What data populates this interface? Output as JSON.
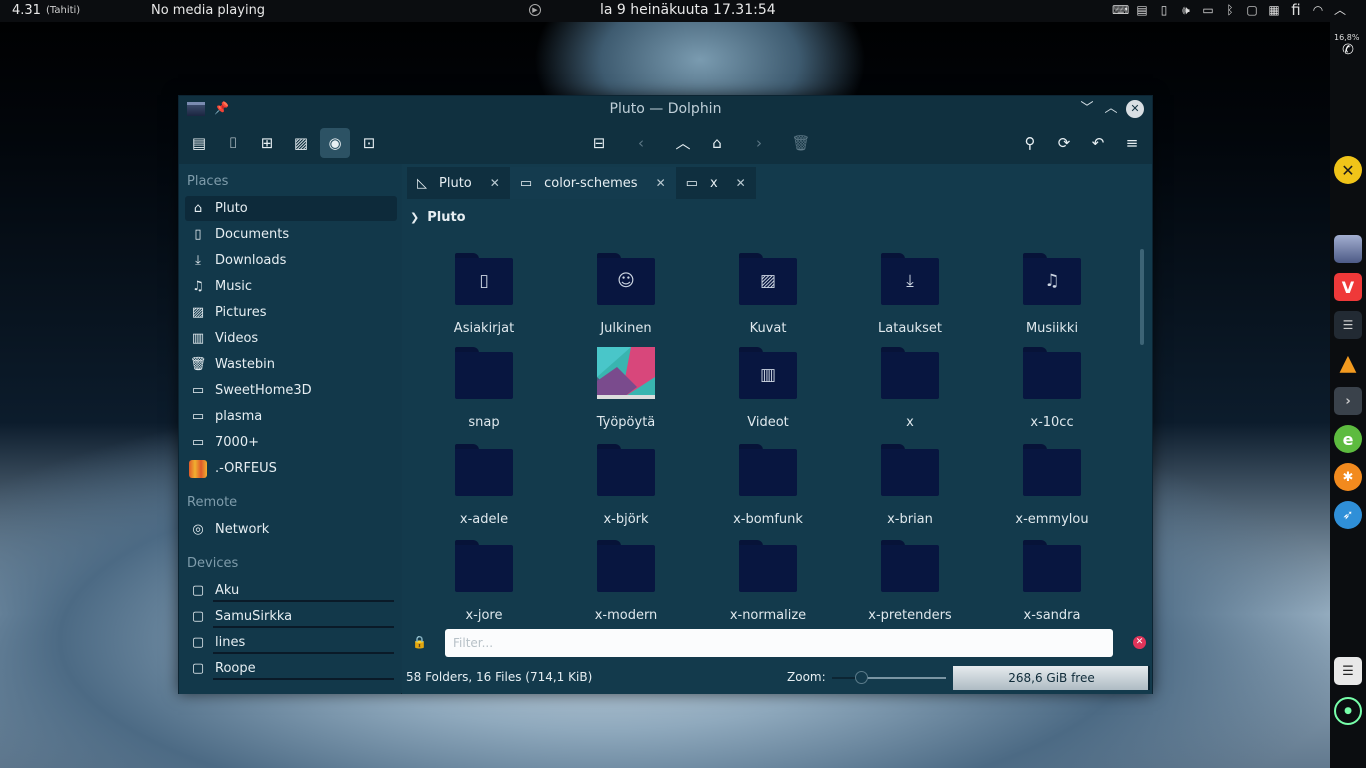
{
  "top_panel": {
    "temperature": "4.31",
    "location": "(Tahiti)",
    "media": "No media playing",
    "clock": "la 9 heinäkuuta 17.31:54",
    "tray_icons": [
      "keyboard-icon",
      "clipboard-icon",
      "phone-icon",
      "volume-icon",
      "display-icon",
      "bluetooth-icon",
      "lock-icon",
      "notes-icon"
    ],
    "language": "fi",
    "network_icon": "wifi-icon"
  },
  "dock": {
    "battery_percent": "16,8%",
    "items": [
      "phone-icon",
      "x-app-icon",
      "files-icon",
      "vivaldi-icon",
      "mixer-icon",
      "vlc-icon",
      "terminal-icon",
      "editor-icon",
      "orange-icon",
      "bird-icon",
      "notes-icon",
      "system-monitor-icon"
    ]
  },
  "window": {
    "title": "Pluto — Dolphin",
    "titlebar_buttons": [
      "minimize",
      "maximize",
      "close"
    ]
  },
  "toolbar": {
    "left_tools": [
      "panels-icon",
      "terminal-icon",
      "new-window-icon",
      "preview-icon",
      "eye-icon",
      "new-tab-icon"
    ],
    "center_tools": [
      "split-icon",
      "back-icon",
      "up-icon",
      "home-icon",
      "forward-icon",
      "trash-icon"
    ],
    "right_tools": [
      "search-icon",
      "reload-icon",
      "undo-icon",
      "menu-icon"
    ]
  },
  "sidebar": {
    "places_title": "Places",
    "places": [
      {
        "label": "Pluto",
        "icon": "home-icon",
        "selected": true
      },
      {
        "label": "Documents",
        "icon": "document-icon"
      },
      {
        "label": "Downloads",
        "icon": "download-icon"
      },
      {
        "label": "Music",
        "icon": "music-icon"
      },
      {
        "label": "Pictures",
        "icon": "picture-icon"
      },
      {
        "label": "Videos",
        "icon": "video-icon"
      },
      {
        "label": "Wastebin",
        "icon": "trash-icon"
      },
      {
        "label": "SweetHome3D",
        "icon": "folder-icon"
      },
      {
        "label": "plasma",
        "icon": "folder-icon"
      },
      {
        "label": "7000+",
        "icon": "folder-icon"
      },
      {
        "label": ".-ORFEUS",
        "icon": "orfeus-icon"
      }
    ],
    "remote_title": "Remote",
    "remote": [
      {
        "label": "Network",
        "icon": "network-icon"
      }
    ],
    "devices_title": "Devices",
    "devices": [
      {
        "label": "Aku",
        "icon": "drive-icon"
      },
      {
        "label": "SamuSirkka",
        "icon": "drive-icon"
      },
      {
        "label": "lines",
        "icon": "drive-icon"
      },
      {
        "label": "Roope",
        "icon": "drive-icon"
      }
    ]
  },
  "tabs": [
    {
      "label": "Pluto",
      "icon": "pluto-icon",
      "active": true
    },
    {
      "label": "color-schemes",
      "icon": "folder-icon",
      "active": false
    },
    {
      "label": "x",
      "icon": "folder-icon",
      "active": true
    }
  ],
  "breadcrumb": {
    "label": "Pluto"
  },
  "files": [
    {
      "name": "Asiakirjat",
      "glyph": "document-glyph"
    },
    {
      "name": "Julkinen",
      "glyph": "people-glyph"
    },
    {
      "name": "Kuvat",
      "glyph": "picture-glyph"
    },
    {
      "name": "Lataukset",
      "glyph": "download-glyph"
    },
    {
      "name": "Musiikki",
      "glyph": "music-glyph"
    },
    {
      "name": "snap",
      "glyph": ""
    },
    {
      "name": "Työpöytä",
      "glyph": "wallpaper-thumbnail"
    },
    {
      "name": "Videot",
      "glyph": "video-glyph"
    },
    {
      "name": "x",
      "glyph": ""
    },
    {
      "name": "x-10cc",
      "glyph": ""
    },
    {
      "name": "x-adele",
      "glyph": ""
    },
    {
      "name": "x-björk",
      "glyph": ""
    },
    {
      "name": "x-bomfunk",
      "glyph": ""
    },
    {
      "name": "x-brian",
      "glyph": ""
    },
    {
      "name": "x-emmylou",
      "glyph": ""
    },
    {
      "name": "x-jore",
      "glyph": ""
    },
    {
      "name": "x-modern",
      "glyph": ""
    },
    {
      "name": "x-normalize",
      "glyph": ""
    },
    {
      "name": "x-pretenders",
      "glyph": ""
    },
    {
      "name": "x-sandra",
      "glyph": ""
    }
  ],
  "filter": {
    "placeholder": "Filter...",
    "value": ""
  },
  "status": {
    "summary": "58 Folders, 16 Files (714,1 KiB)",
    "zoom_label": "Zoom:",
    "zoom_level": 0.25,
    "free_space": "268,6 GiB free",
    "used_fraction": 0.99
  },
  "colors": {
    "window_bg": "#133a4c",
    "folder": "#081640",
    "accent_close": "#e0345a"
  }
}
